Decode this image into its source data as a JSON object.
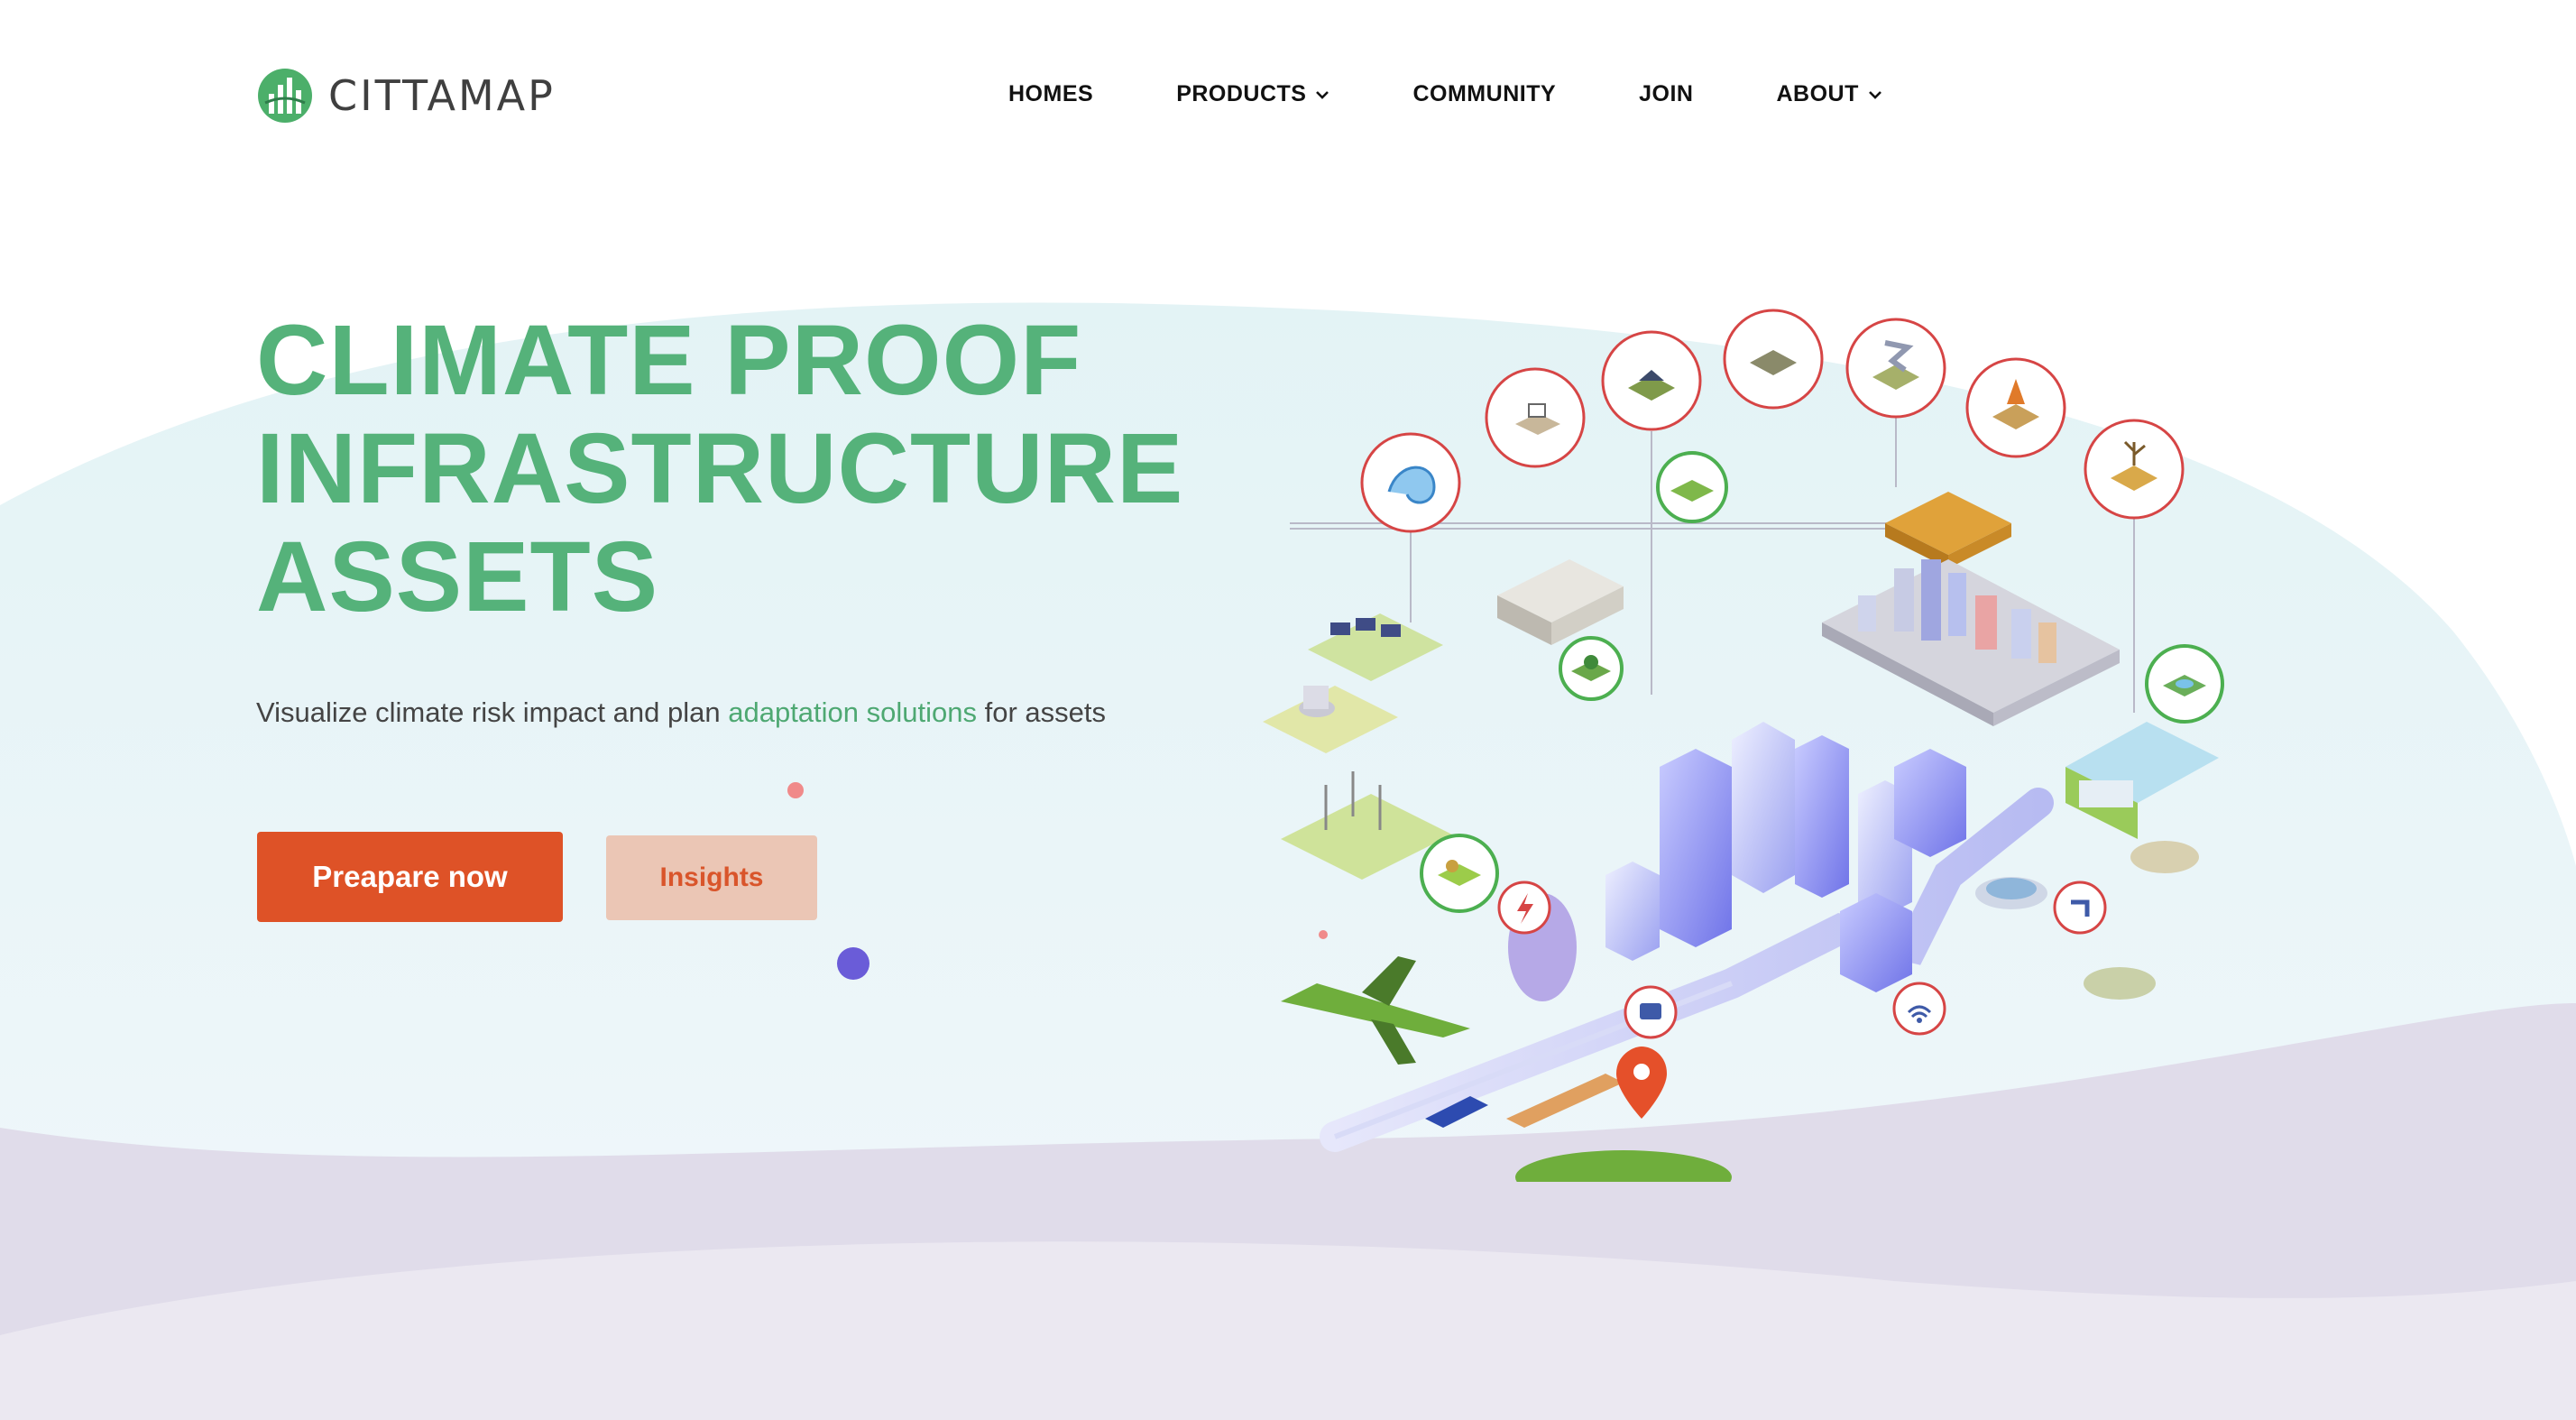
{
  "brand": {
    "name": "CITTAMAP",
    "logo_icon": "city-logo-icon"
  },
  "nav": {
    "items": [
      {
        "label": "HOMES",
        "has_dropdown": false
      },
      {
        "label": "PRODUCTS",
        "has_dropdown": true
      },
      {
        "label": "COMMUNITY",
        "has_dropdown": false
      },
      {
        "label": "JOIN",
        "has_dropdown": false
      },
      {
        "label": "ABOUT",
        "has_dropdown": true
      }
    ]
  },
  "hero": {
    "title_lines": [
      "CLIMATE PROOF",
      "INFRASTRUCTURE",
      "ASSETS"
    ],
    "subtitle_before": "Visualize climate risk impact and plan",
    "subtitle_highlight": "adaptation solutions",
    "subtitle_after": "for assets",
    "primary_button": "Preapare now",
    "secondary_button": "Insights"
  },
  "colors": {
    "brand_green": "#55b27a",
    "primary_orange": "#de5227",
    "secondary_peach": "#ebc6b5",
    "risk_ring_red": "#d64545",
    "solution_ring_green": "#4caf50"
  },
  "illustration": {
    "risk_icons": [
      "flood-wave-icon",
      "landslide-house-icon",
      "storm-house-icon",
      "erosion-icon",
      "tornado-icon",
      "wildfire-icon",
      "drought-icon"
    ],
    "solution_icons": [
      "green-roof-icon",
      "forest-icon",
      "green-park-icon",
      "wetland-icon"
    ],
    "utility_icons": [
      "power-icon",
      "bus-icon",
      "wifi-icon",
      "water-tap-icon",
      "location-pin-icon"
    ]
  }
}
